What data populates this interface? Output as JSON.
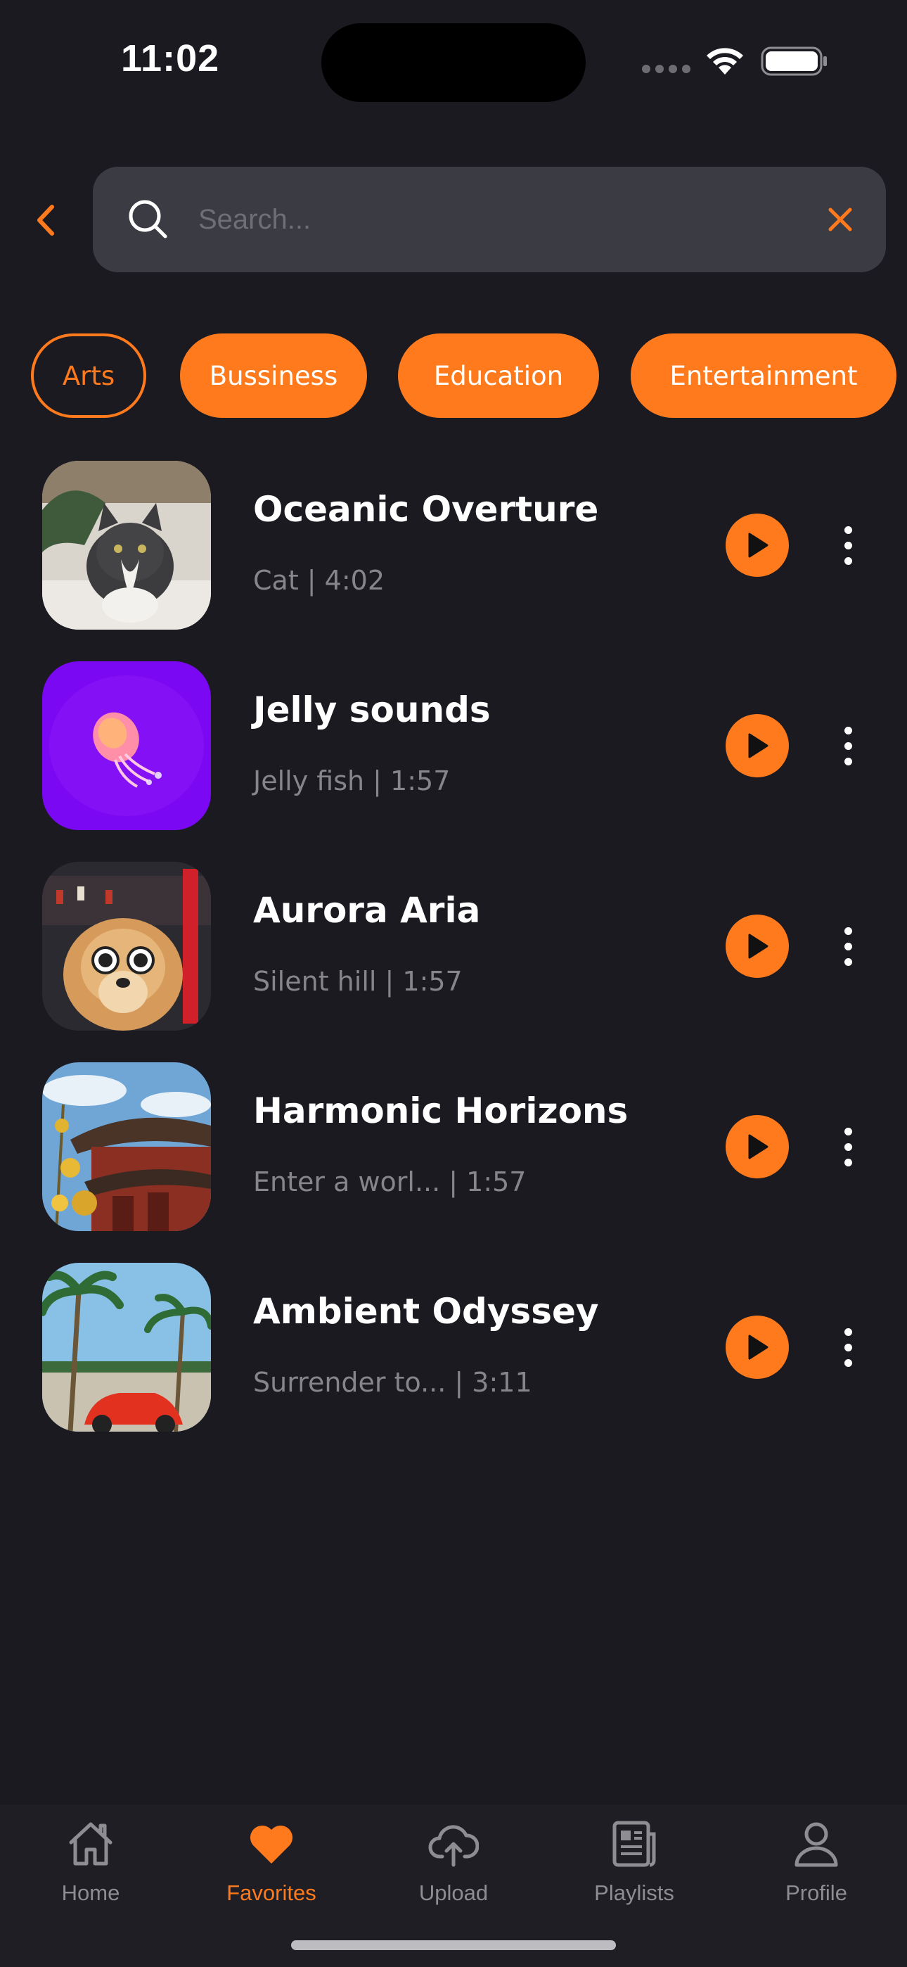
{
  "status_bar": {
    "time": "11:02"
  },
  "search": {
    "placeholder": "Search...",
    "value": ""
  },
  "categories": [
    {
      "label": "Arts",
      "selected": true
    },
    {
      "label": "Bussiness",
      "selected": false
    },
    {
      "label": "Education",
      "selected": false
    },
    {
      "label": "Entertainment",
      "selected": false
    }
  ],
  "tracks": [
    {
      "title": "Oceanic Overture",
      "subtitle": "Cat | 4:02",
      "thumb_icon": "cat-photo"
    },
    {
      "title": "Jelly sounds",
      "subtitle": "Jelly fish | 1:57",
      "thumb_icon": "jellyfish-photo"
    },
    {
      "title": "Aurora Aria",
      "subtitle": "Silent hill | 1:57",
      "thumb_icon": "dog-sunglasses-photo"
    },
    {
      "title": "Harmonic Horizons",
      "subtitle": "Enter a worl... | 1:57",
      "thumb_icon": "pagoda-photo"
    },
    {
      "title": "Ambient Odyssey",
      "subtitle": "Surrender to... | 3:11",
      "thumb_icon": "palm-car-photo"
    }
  ],
  "tab_bar": {
    "items": [
      {
        "label": "Home",
        "icon": "home-icon",
        "active": false
      },
      {
        "label": "Favorites",
        "icon": "heart-icon",
        "active": true
      },
      {
        "label": "Upload",
        "icon": "cloud-upload-icon",
        "active": false
      },
      {
        "label": "Playlists",
        "icon": "document-icon",
        "active": false
      },
      {
        "label": "Profile",
        "icon": "user-icon",
        "active": false
      }
    ]
  },
  "colors": {
    "accent": "#ff7a1c",
    "background": "#1b1a20",
    "surface": "#3a3b43",
    "muted_text": "#85858a"
  }
}
